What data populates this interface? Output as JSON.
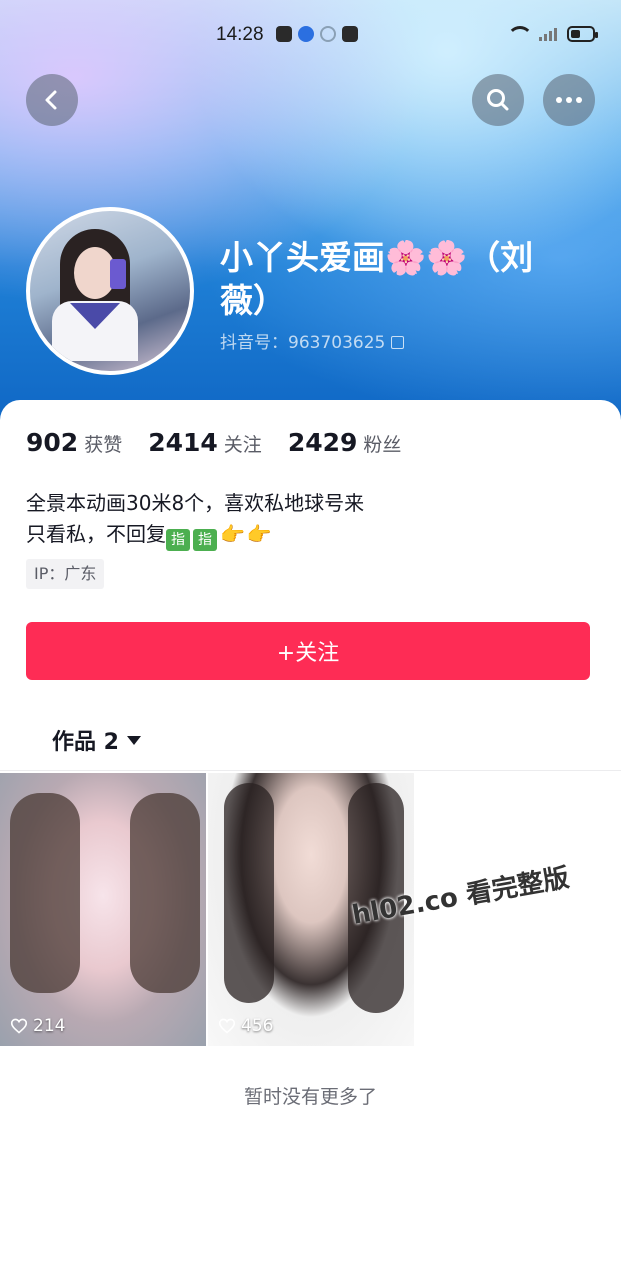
{
  "status_bar": {
    "time": "14:28"
  },
  "profile": {
    "name": "小丫头爱画🌸🌸（刘薇）",
    "douyin_id": "抖音号：963703625"
  },
  "stats": [
    {
      "value": "902",
      "label": "获赞"
    },
    {
      "value": "2414",
      "label": "关注"
    },
    {
      "value": "2429",
      "label": "粉丝"
    }
  ],
  "bio": {
    "line1": "全景本动画30米8个，喜欢私地球号来",
    "line2_text": "只看私，不回复",
    "line2_tags": [
      "指",
      "指"
    ],
    "line2_emoji": [
      "👉",
      "👉"
    ]
  },
  "ip": "IP：广东",
  "follow_button": "+关注",
  "works_tab": "作品 2",
  "videos": [
    {
      "likes": "214"
    },
    {
      "likes": "456"
    }
  ],
  "watermark": "hl02.co 看完整版",
  "footer": "暂时没有更多了",
  "colors": {
    "accent": "#fe2c55",
    "header_blue": "#1f80d6"
  },
  "icons": [
    "back-icon",
    "search-icon",
    "more-icon",
    "copy-icon",
    "heart-icon",
    "caret-down-icon"
  ]
}
